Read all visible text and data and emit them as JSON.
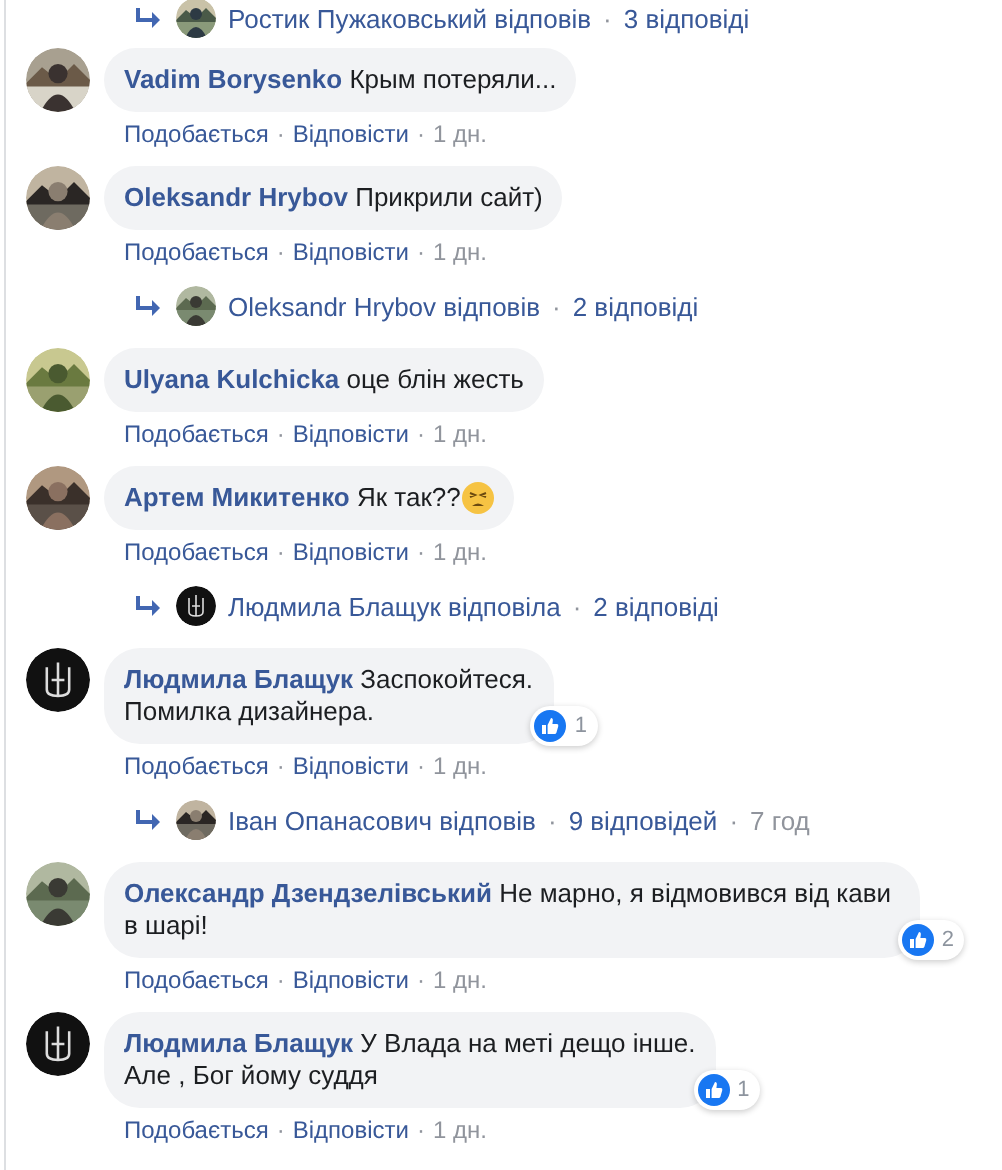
{
  "thread": [
    {
      "kind": "reply_summary",
      "parts": [
        {
          "kind": "name",
          "text": "Ростик Пужаковський відповів"
        },
        {
          "kind": "sep",
          "text": "·"
        },
        {
          "kind": "count",
          "text": "3 відповіді"
        }
      ]
    },
    {
      "kind": "comment",
      "author": "Vadim Borysenko",
      "text": "Крым потеряли...",
      "emoji": false,
      "actions": [
        {
          "kind": "link",
          "text": "Подобається"
        },
        {
          "kind": "sep",
          "text": "·"
        },
        {
          "kind": "link",
          "text": "Відповісти"
        },
        {
          "kind": "sep",
          "text": "·"
        },
        {
          "kind": "time",
          "text": "1 дн."
        }
      ]
    },
    {
      "kind": "comment",
      "author": "Oleksandr Hrybov",
      "text": "Прикрили сайт)",
      "emoji": false,
      "actions": [
        {
          "kind": "link",
          "text": "Подобається"
        },
        {
          "kind": "sep",
          "text": "·"
        },
        {
          "kind": "link",
          "text": "Відповісти"
        },
        {
          "kind": "sep",
          "text": "·"
        },
        {
          "kind": "time",
          "text": "1 дн."
        }
      ]
    },
    {
      "kind": "reply_summary",
      "parts": [
        {
          "kind": "name",
          "text": "Oleksandr Hrybov відповів"
        },
        {
          "kind": "sep",
          "text": "·"
        },
        {
          "kind": "count",
          "text": "2 відповіді"
        }
      ]
    },
    {
      "kind": "comment",
      "author": "Ulyana Kulchicka",
      "text": "оце блін жесть",
      "emoji": false,
      "actions": [
        {
          "kind": "link",
          "text": "Подобається"
        },
        {
          "kind": "sep",
          "text": "·"
        },
        {
          "kind": "link",
          "text": "Відповісти"
        },
        {
          "kind": "sep",
          "text": "·"
        },
        {
          "kind": "time",
          "text": "1 дн."
        }
      ]
    },
    {
      "kind": "comment",
      "author": "Артем Микитенко",
      "text": "Як так??",
      "emoji": true,
      "actions": [
        {
          "kind": "link",
          "text": "Подобається"
        },
        {
          "kind": "sep",
          "text": "·"
        },
        {
          "kind": "link",
          "text": "Відповісти"
        },
        {
          "kind": "sep",
          "text": "·"
        },
        {
          "kind": "time",
          "text": "1 дн."
        }
      ]
    },
    {
      "kind": "reply_summary",
      "avatar": {
        "kind": "emblem"
      },
      "parts": [
        {
          "kind": "name",
          "text": "Людмила Блащук відповіла"
        },
        {
          "kind": "sep",
          "text": "·"
        },
        {
          "kind": "count",
          "text": "2 відповіді"
        }
      ]
    },
    {
      "kind": "comment",
      "avatar": {
        "kind": "emblem"
      },
      "author": "Людмила Блащук",
      "text": "Заспокойтеся.\nПомилка дизайнера.",
      "emoji": false,
      "likes": "1",
      "actions": [
        {
          "kind": "link",
          "text": "Подобається"
        },
        {
          "kind": "sep",
          "text": "·"
        },
        {
          "kind": "link",
          "text": "Відповісти"
        },
        {
          "kind": "sep",
          "text": "·"
        },
        {
          "kind": "time",
          "text": "1 дн."
        }
      ]
    },
    {
      "kind": "reply_summary",
      "parts": [
        {
          "kind": "name",
          "text": "Іван Опанасович відповів"
        },
        {
          "kind": "sep",
          "text": "·"
        },
        {
          "kind": "count",
          "text": "9 відповідей"
        },
        {
          "kind": "sep",
          "text": "·"
        },
        {
          "kind": "time",
          "text": "7 год"
        }
      ]
    },
    {
      "kind": "comment",
      "author": "Олександр Дзендзелівський",
      "text": "Не марно, я відмовився від кави в шарі!",
      "emoji": false,
      "likes": "2",
      "actions": [
        {
          "kind": "link",
          "text": "Подобається"
        },
        {
          "kind": "sep",
          "text": "·"
        },
        {
          "kind": "link",
          "text": "Відповісти"
        },
        {
          "kind": "sep",
          "text": "·"
        },
        {
          "kind": "time",
          "text": "1 дн."
        }
      ]
    },
    {
      "kind": "comment",
      "avatar": {
        "kind": "emblem"
      },
      "author": "Людмила Блащук",
      "text": "У Влада на меті дещо інше.\nАле , Бог йому суддя",
      "emoji": false,
      "likes": "1",
      "actions": [
        {
          "kind": "link",
          "text": "Подобається"
        },
        {
          "kind": "sep",
          "text": "·"
        },
        {
          "kind": "link",
          "text": "Відповісти"
        },
        {
          "kind": "sep",
          "text": "·"
        },
        {
          "kind": "time",
          "text": "1 дн."
        }
      ]
    }
  ]
}
